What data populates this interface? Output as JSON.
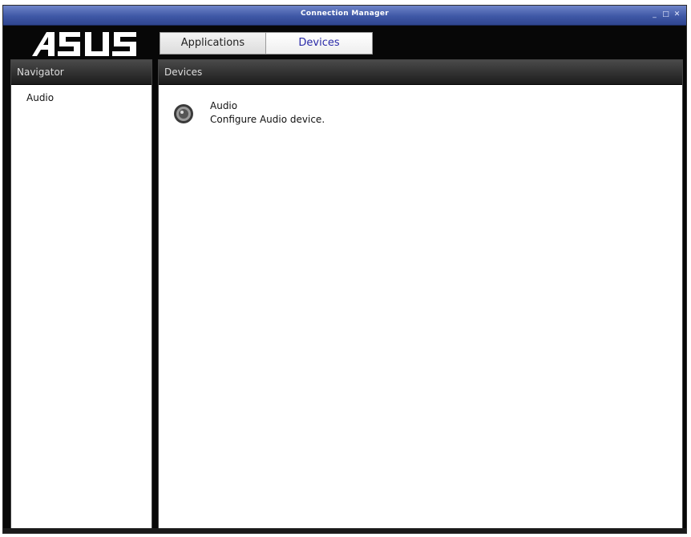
{
  "window": {
    "title": "Connection Manager",
    "controls": [
      "_",
      "□",
      "✕"
    ]
  },
  "logo": {
    "text": "ASUS"
  },
  "tabs": [
    {
      "label": "Applications",
      "active": false
    },
    {
      "label": "Devices",
      "active": true
    }
  ],
  "navigator": {
    "header": "Navigator",
    "items": [
      {
        "label": "Audio"
      }
    ]
  },
  "devices_panel": {
    "header": "Devices",
    "items": [
      {
        "name": "Audio",
        "description": "Configure Audio device.",
        "icon": "speaker-icon"
      }
    ]
  },
  "colors": {
    "titlebar": "#3f58a6",
    "frame": "#070707",
    "active_tab_text": "#2a2aa8"
  }
}
